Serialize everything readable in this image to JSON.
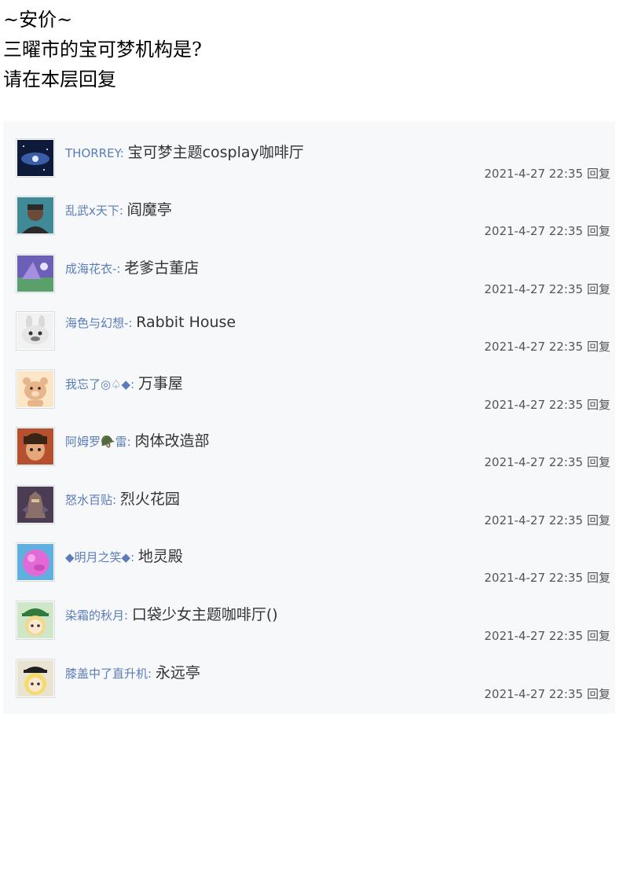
{
  "post": {
    "lines": [
      "~安价~",
      "三曜市的宝可梦机构是?",
      "请在本层回复"
    ]
  },
  "reply_action_label": "回复",
  "replies": [
    {
      "username": "THORREY:",
      "text": "宝可梦主题cosplay咖啡厅",
      "time": "2021-4-27 22:35",
      "avatar_icon": "galaxy-avatar-icon",
      "avatar_colors": [
        "#0d1a3a",
        "#4e7bd6"
      ]
    },
    {
      "username": "乱武x天下:",
      "text": "阎魔亭",
      "time": "2021-4-27 22:35",
      "avatar_icon": "person-avatar-icon",
      "avatar_colors": [
        "#3f8a96",
        "#2b2b2b"
      ]
    },
    {
      "username": "成海花衣-:",
      "text": "老爹古董店",
      "time": "2021-4-27 22:35",
      "avatar_icon": "anime-scene-avatar-icon",
      "avatar_colors": [
        "#6b5fb8",
        "#59a06a"
      ]
    },
    {
      "username": "海色与幻想-:",
      "text": "Rabbit House",
      "time": "2021-4-27 22:35",
      "avatar_icon": "rabbit-avatar-icon",
      "avatar_colors": [
        "#f2f2f2",
        "#7a7a7a"
      ]
    },
    {
      "username": "我忘了◎♤◆:",
      "text": "万事屋",
      "time": "2021-4-27 22:35",
      "avatar_icon": "bear-avatar-icon",
      "avatar_colors": [
        "#fbe6c8",
        "#e8b58a"
      ]
    },
    {
      "username": "阿姆罗🪖雷:",
      "text": "肉体改造部",
      "time": "2021-4-27 22:35",
      "avatar_icon": "anime-boy-avatar-icon",
      "avatar_colors": [
        "#b5512f",
        "#3a2418"
      ]
    },
    {
      "username": "怒水百贴:",
      "text": "烈火花园",
      "time": "2021-4-27 22:35",
      "avatar_icon": "robot-avatar-icon",
      "avatar_colors": [
        "#4a3c52",
        "#8a7068"
      ]
    },
    {
      "username": "◆明月之笑◆:",
      "text": "地灵殿",
      "time": "2021-4-27 22:35",
      "avatar_icon": "pink-ball-avatar-icon",
      "avatar_colors": [
        "#5fb0e0",
        "#e26ad6"
      ]
    },
    {
      "username": "染霜的秋月:",
      "text": "口袋少女主题咖啡厅()",
      "time": "2021-4-27 22:35",
      "avatar_icon": "green-hat-girl-avatar-icon",
      "avatar_colors": [
        "#2f7a3c",
        "#f1d98a"
      ]
    },
    {
      "username": "膝盖中了直升机:",
      "text": "永远亭",
      "time": "2021-4-27 22:35",
      "avatar_icon": "blonde-girl-avatar-icon",
      "avatar_colors": [
        "#1f1f1f",
        "#f3dc6a"
      ]
    }
  ]
}
